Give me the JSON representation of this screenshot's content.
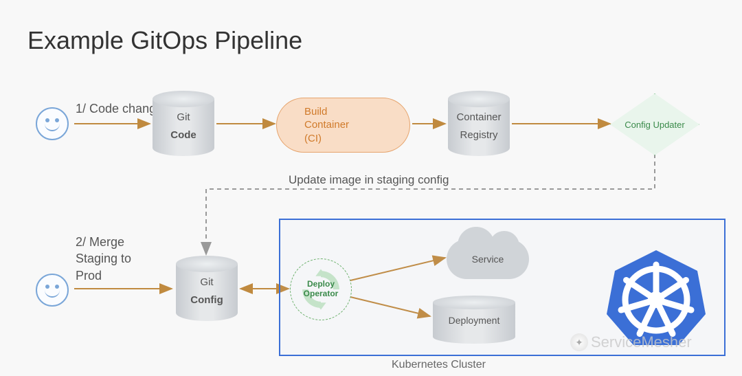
{
  "title": "Example GitOps Pipeline",
  "step1_label": "1/ Code change",
  "step2_label_l1": "2/ Merge",
  "step2_label_l2": "Staging to",
  "step2_label_l3": "Prod",
  "git_code_top": "Git",
  "git_code_bottom": "Code",
  "git_config_top": "Git",
  "git_config_bottom": "Config",
  "build_l1": "Build",
  "build_l2": "Container",
  "build_l3": "(CI)",
  "registry_l1": "Container",
  "registry_l2": "Registry",
  "config_updater": "Config Updater",
  "update_image_label": "Update image in staging config",
  "deploy_l1": "Deploy",
  "deploy_l2": "Operator",
  "service_label": "Service",
  "deployment_label": "Deployment",
  "cluster_label": "Kubernetes Cluster",
  "watermark": "ServiceMesher",
  "colors": {
    "arrow": "#c08a3f",
    "dashed": "#999999",
    "cluster_border": "#3b6fd6",
    "k8s_blue": "#3b6fd6"
  }
}
